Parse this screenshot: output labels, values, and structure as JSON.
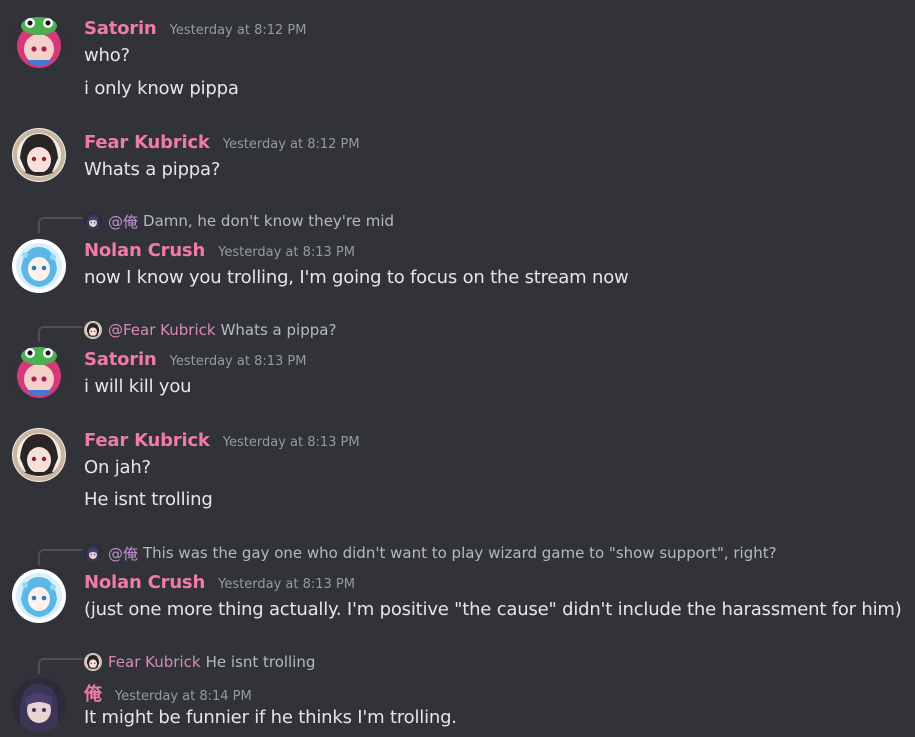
{
  "messages": [
    {
      "user": "Satorin",
      "timestamp": "Yesterday at 8:12 PM",
      "lines": [
        "who?",
        "i only know pippa"
      ]
    },
    {
      "user": "Fear Kubrick",
      "timestamp": "Yesterday at 8:12 PM",
      "lines": [
        "Whats a pippa?"
      ]
    },
    {
      "reply": {
        "mention": "@俺",
        "text": "Damn, he don't know they're mid"
      },
      "user": "Nolan Crush",
      "timestamp": "Yesterday at 8:13 PM",
      "lines": [
        "now I know you trolling, I'm going to focus on the stream now"
      ]
    },
    {
      "reply": {
        "mention": "@Fear Kubrick",
        "text": "Whats a pippa?"
      },
      "user": "Satorin",
      "timestamp": "Yesterday at 8:13 PM",
      "lines": [
        "i will kill you"
      ]
    },
    {
      "user": "Fear Kubrick",
      "timestamp": "Yesterday at 8:13 PM",
      "lines": [
        "On jah?",
        "He isnt trolling"
      ]
    },
    {
      "reply": {
        "mention": "@俺",
        "text": "This was the gay one who didn't want to play wizard game to \"show support\", right?"
      },
      "user": "Nolan Crush",
      "timestamp": "Yesterday at 8:13 PM",
      "lines": [
        "(just one more thing actually. I'm positive \"the cause\" didn't include the harassment for him)"
      ]
    },
    {
      "reply": {
        "mention": "Fear Kubrick",
        "text": "He isnt trolling"
      },
      "user": "俺",
      "timestamp": "Yesterday at 8:14 PM",
      "lines": [
        "It might be funnier if he thinks I'm trolling."
      ]
    }
  ],
  "colors": {
    "background": "#313338",
    "username": "#f07aa9",
    "timestamp": "#949ba4",
    "text": "#dbdee1"
  },
  "avatars": [
    "satorin-avatar",
    "fear-kubrick-avatar",
    "nolan-crush-avatar",
    "ore-avatar"
  ]
}
